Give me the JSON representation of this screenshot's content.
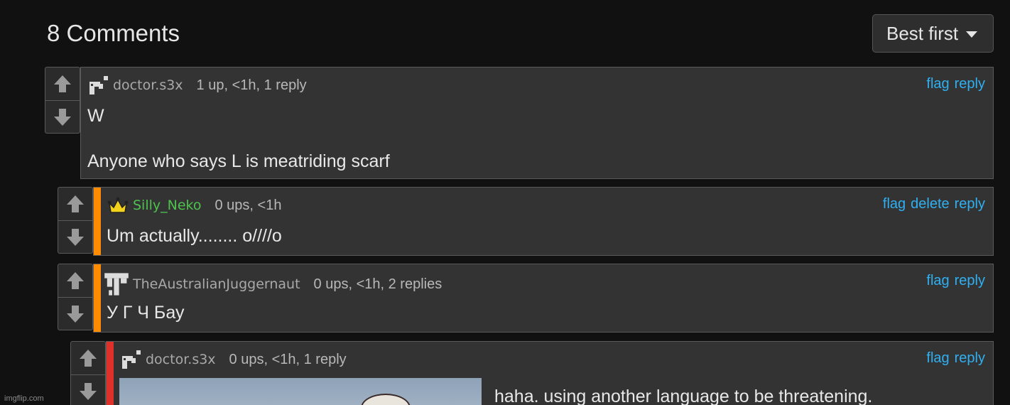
{
  "header": {
    "title": "8 Comments",
    "sort_label": "Best first"
  },
  "comments": [
    {
      "username": "doctor.s3x",
      "stats": "1 up, <1h, 1 reply",
      "actions": [
        "flag",
        "reply"
      ],
      "lines": [
        "W",
        "Anyone who says L is meatriding scarf"
      ]
    },
    {
      "username": "Silly_Neko",
      "stats": "0 ups, <1h",
      "actions": [
        "flag",
        "delete",
        "reply"
      ],
      "lines": [
        "Um actually........ o////o"
      ],
      "stripe_color": "#ff8c00"
    },
    {
      "username": "TheAustralianJuggernaut",
      "stats": "0 ups, <1h, 2 replies",
      "actions": [
        "flag",
        "reply"
      ],
      "lines": [
        "У Г Ч Бау"
      ],
      "stripe_color": "#ff8c00"
    },
    {
      "username": "doctor.s3x",
      "stats": "0 ups, <1h, 1 reply",
      "actions": [
        "flag",
        "reply"
      ],
      "lines": [
        "haha. using another language to be threatening."
      ],
      "stripe_color": "#e0302a"
    }
  ],
  "watermark": "imgflip.com",
  "icons": {
    "upvote": "arrow-up-icon",
    "downvote": "arrow-down-icon",
    "sort": "chevron-down-icon",
    "crown": "crown-icon"
  },
  "colors": {
    "link": "#2fb0f2",
    "mod_username": "#4ec24e"
  }
}
